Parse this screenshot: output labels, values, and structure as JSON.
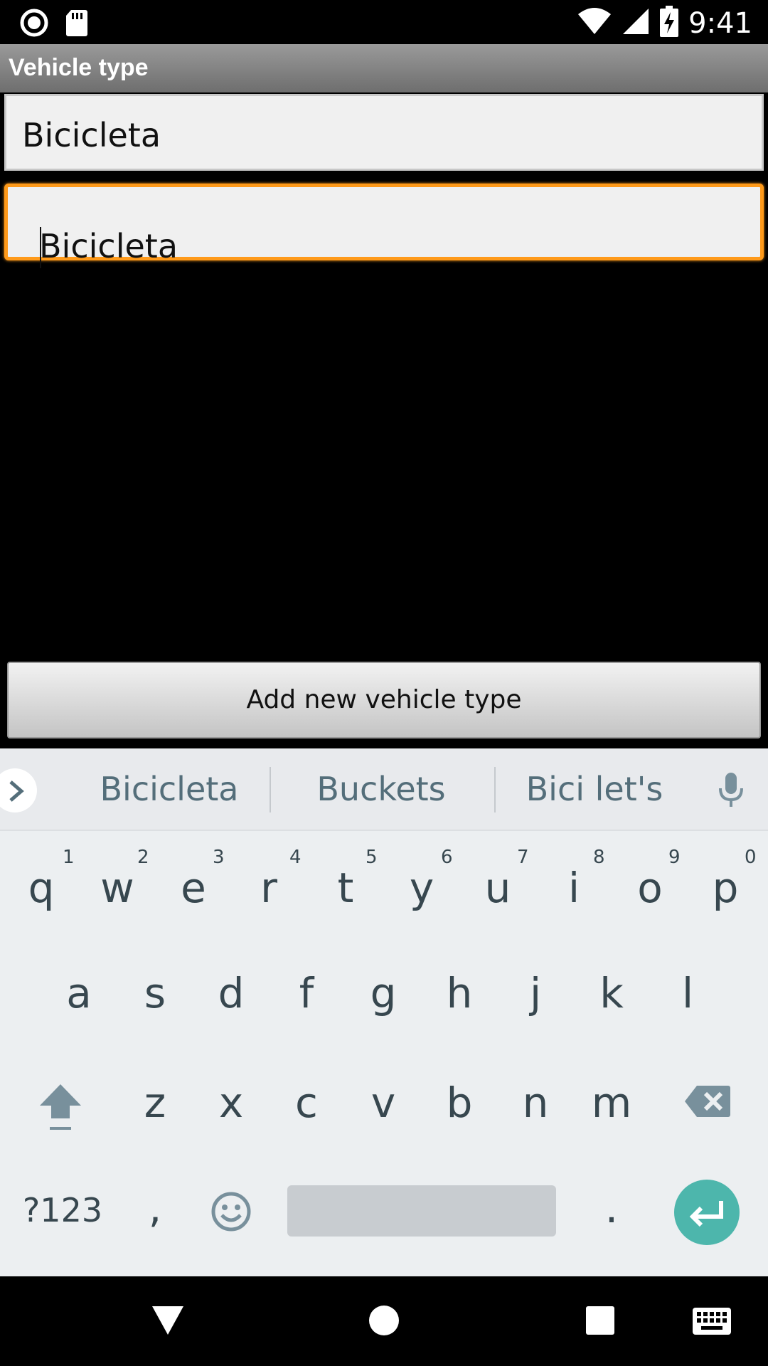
{
  "status_bar": {
    "time": "9:41",
    "left_icons": [
      "record-icon",
      "sd-card-icon"
    ],
    "right_icons": [
      "wifi-icon",
      "signal-icon",
      "battery-charging-icon"
    ]
  },
  "title_bar": {
    "title": "Vehicle type"
  },
  "fields": [
    {
      "value": "Bicicleta",
      "focused": false
    },
    {
      "value": "Bicicleta",
      "focused": true
    }
  ],
  "add_button": {
    "label": "Add new vehicle type"
  },
  "keyboard": {
    "suggestions": [
      "Bicicleta",
      "Buckets",
      "Bici let's"
    ],
    "row1": [
      "q",
      "w",
      "e",
      "r",
      "t",
      "y",
      "u",
      "i",
      "o",
      "p"
    ],
    "row1_hints": [
      "1",
      "2",
      "3",
      "4",
      "5",
      "6",
      "7",
      "8",
      "9",
      "0"
    ],
    "row2": [
      "a",
      "s",
      "d",
      "f",
      "g",
      "h",
      "j",
      "k",
      "l"
    ],
    "row3": [
      "z",
      "x",
      "c",
      "v",
      "b",
      "n",
      "m"
    ],
    "symbols_key": "?123",
    "comma_key": ",",
    "period_key": ".",
    "colors": {
      "enter": "#4db6ac",
      "background": "#eceff1",
      "key_text": "#37474f"
    }
  },
  "nav_bar": {
    "icons": [
      "back-icon",
      "home-icon",
      "recents-icon",
      "keyboard-switch-icon"
    ]
  },
  "accent_color": "#ff9a1a"
}
